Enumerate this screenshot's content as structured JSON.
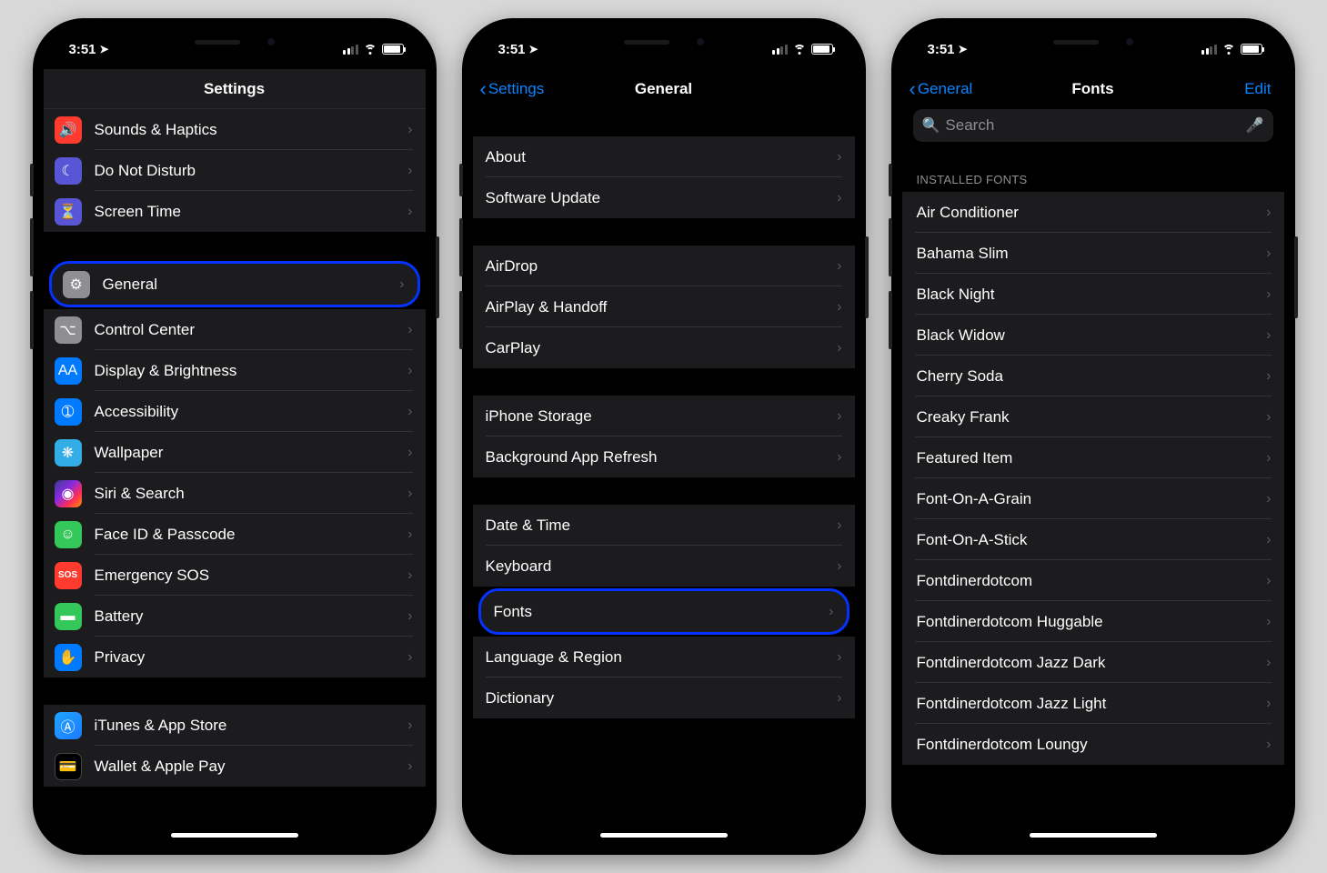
{
  "status": {
    "time": "3:51"
  },
  "phone1": {
    "title": "Settings",
    "rows_a": [
      {
        "label": "Sounds & Haptics",
        "icon": "sound-icon",
        "ic": "ic-red",
        "glyph": "🔊"
      },
      {
        "label": "Do Not Disturb",
        "icon": "moon-icon",
        "ic": "ic-purple",
        "glyph": "☾"
      },
      {
        "label": "Screen Time",
        "icon": "hourglass-icon",
        "ic": "ic-purple2",
        "glyph": "⏳"
      }
    ],
    "rows_b": [
      {
        "label": "General",
        "icon": "gear-icon",
        "ic": "ic-gray",
        "glyph": "⚙",
        "hl": true
      },
      {
        "label": "Control Center",
        "icon": "toggles-icon",
        "ic": "ic-gray",
        "glyph": "⌥"
      },
      {
        "label": "Display & Brightness",
        "icon": "aa-icon",
        "ic": "ic-blue",
        "glyph": "AA"
      },
      {
        "label": "Accessibility",
        "icon": "accessibility-icon",
        "ic": "ic-blue",
        "glyph": "➀"
      },
      {
        "label": "Wallpaper",
        "icon": "flower-icon",
        "ic": "ic-teal",
        "glyph": "❋"
      },
      {
        "label": "Siri & Search",
        "icon": "siri-icon",
        "ic": "ic-siri",
        "glyph": "◉"
      },
      {
        "label": "Face ID & Passcode",
        "icon": "face-icon",
        "ic": "ic-green",
        "glyph": "☺"
      },
      {
        "label": "Emergency SOS",
        "icon": "sos-icon",
        "ic": "ic-sos",
        "glyph": "SOS"
      },
      {
        "label": "Battery",
        "icon": "battery-icon",
        "ic": "ic-green",
        "glyph": "▬"
      },
      {
        "label": "Privacy",
        "icon": "hand-icon",
        "ic": "ic-hand",
        "glyph": "✋"
      }
    ],
    "rows_c": [
      {
        "label": "iTunes & App Store",
        "icon": "appstore-icon",
        "ic": "ic-itunes",
        "glyph": "Ⓐ"
      },
      {
        "label": "Wallet & Apple Pay",
        "icon": "wallet-icon",
        "ic": "ic-wallet",
        "glyph": "💳"
      }
    ]
  },
  "phone2": {
    "back": "Settings",
    "title": "General",
    "g1": [
      {
        "label": "About"
      },
      {
        "label": "Software Update"
      }
    ],
    "g2": [
      {
        "label": "AirDrop"
      },
      {
        "label": "AirPlay & Handoff"
      },
      {
        "label": "CarPlay"
      }
    ],
    "g3": [
      {
        "label": "iPhone Storage"
      },
      {
        "label": "Background App Refresh"
      }
    ],
    "g4": [
      {
        "label": "Date & Time"
      },
      {
        "label": "Keyboard"
      },
      {
        "label": "Fonts",
        "hl": true
      },
      {
        "label": "Language & Region"
      },
      {
        "label": "Dictionary"
      }
    ]
  },
  "phone3": {
    "back": "General",
    "title": "Fonts",
    "edit": "Edit",
    "search_placeholder": "Search",
    "section": "INSTALLED FONTS",
    "fonts": [
      "Air Conditioner",
      "Bahama Slim",
      "Black Night",
      "Black Widow",
      "Cherry Soda",
      "Creaky Frank",
      "Featured Item",
      "Font-On-A-Grain",
      "Font-On-A-Stick",
      "Fontdinerdotcom",
      "Fontdinerdotcom Huggable",
      "Fontdinerdotcom Jazz Dark",
      "Fontdinerdotcom Jazz Light",
      "Fontdinerdotcom Loungy"
    ]
  }
}
